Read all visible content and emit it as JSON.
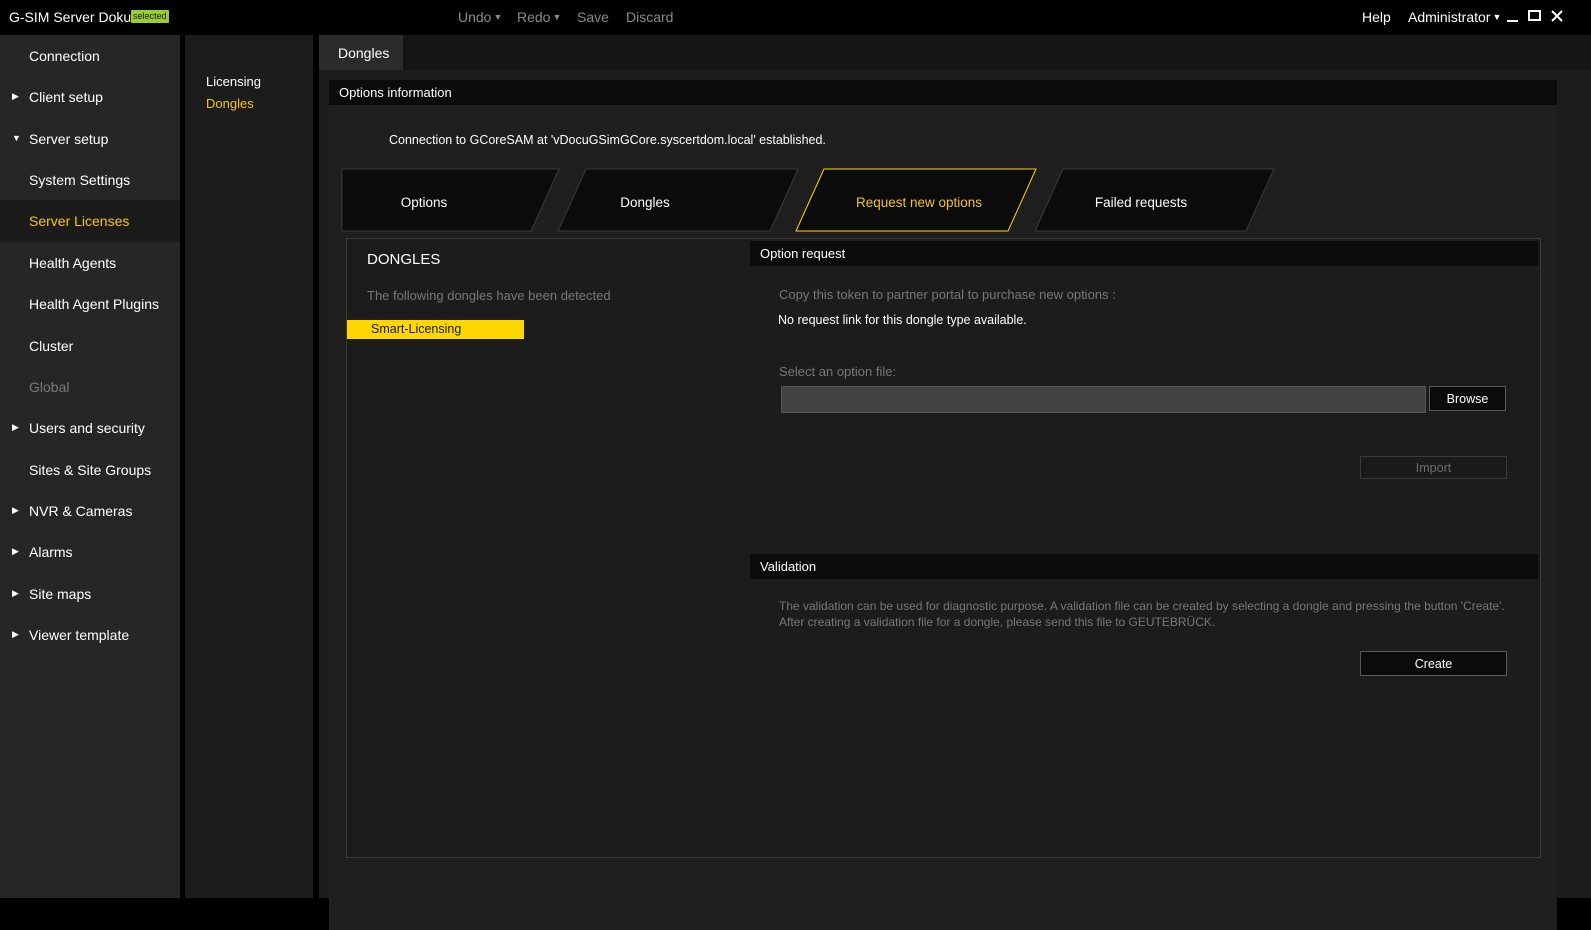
{
  "app": {
    "title": "G-SIM Server Doku",
    "badge": "selected",
    "toolbar": {
      "undo": "Undo",
      "redo": "Redo",
      "save": "Save",
      "discard": "Discard"
    },
    "help": "Help",
    "user": "Administrator"
  },
  "sidebar": {
    "items": [
      {
        "label": "Connection",
        "expandable": false,
        "state": "normal"
      },
      {
        "label": "Client setup",
        "expandable": true,
        "expanded": false,
        "state": "normal"
      },
      {
        "label": "Server setup",
        "expandable": true,
        "expanded": true,
        "state": "normal"
      },
      {
        "label": "System Settings",
        "expandable": false,
        "state": "normal"
      },
      {
        "label": "Server Licenses",
        "expandable": false,
        "state": "active"
      },
      {
        "label": "Health Agents",
        "expandable": false,
        "state": "normal"
      },
      {
        "label": "Health Agent Plugins",
        "expandable": false,
        "state": "normal"
      },
      {
        "label": "Cluster",
        "expandable": false,
        "state": "normal"
      },
      {
        "label": "Global",
        "expandable": false,
        "state": "disabled"
      },
      {
        "label": "Users and security",
        "expandable": true,
        "expanded": false,
        "state": "normal"
      },
      {
        "label": "Sites & Site Groups",
        "expandable": false,
        "state": "normal"
      },
      {
        "label": "NVR & Cameras",
        "expandable": true,
        "expanded": false,
        "state": "normal"
      },
      {
        "label": "Alarms",
        "expandable": true,
        "expanded": false,
        "state": "normal"
      },
      {
        "label": "Site maps",
        "expandable": true,
        "expanded": false,
        "state": "normal"
      },
      {
        "label": "Viewer template",
        "expandable": true,
        "expanded": false,
        "state": "normal"
      }
    ]
  },
  "subnav": {
    "items": [
      {
        "label": "Licensing",
        "active": false
      },
      {
        "label": "Dongles",
        "active": true
      }
    ]
  },
  "main": {
    "tab": "Dongles",
    "options_header": "Options information",
    "connection_message": "Connection to GCoreSAM at 'vDocuGSimGCore.syscertdom.local' established.",
    "tabs": [
      {
        "label": "Options",
        "active": false
      },
      {
        "label": "Dongles",
        "active": false
      },
      {
        "label": "Request new options",
        "active": true
      },
      {
        "label": "Failed requests",
        "active": false
      }
    ],
    "dongles": {
      "title": "DONGLES",
      "subtitle": "The following dongles have been detected",
      "items": [
        "Smart-Licensing"
      ]
    },
    "option_request": {
      "header": "Option request",
      "copy_hint": "Copy this token to partner portal to purchase new options :",
      "no_link": "No request link for this dongle type available.",
      "select_label": "Select an option file:",
      "file_value": "",
      "browse_label": "Browse",
      "import_label": "Import"
    },
    "validation": {
      "header": "Validation",
      "line1": "The validation can be used for diagnostic purpose. A validation file can be created by selecting a dongle and pressing the button 'Create'.",
      "line2": "After creating a validation file for a dongle, please send this file to GEUTEBRÜCK.",
      "create_label": "Create"
    }
  },
  "colors": {
    "accent": "#ffd700",
    "accent_text": "#f5c518",
    "badge": "#9acd32",
    "sidebar_bg": "#262626",
    "panel_bg": "#1c1c1c"
  }
}
